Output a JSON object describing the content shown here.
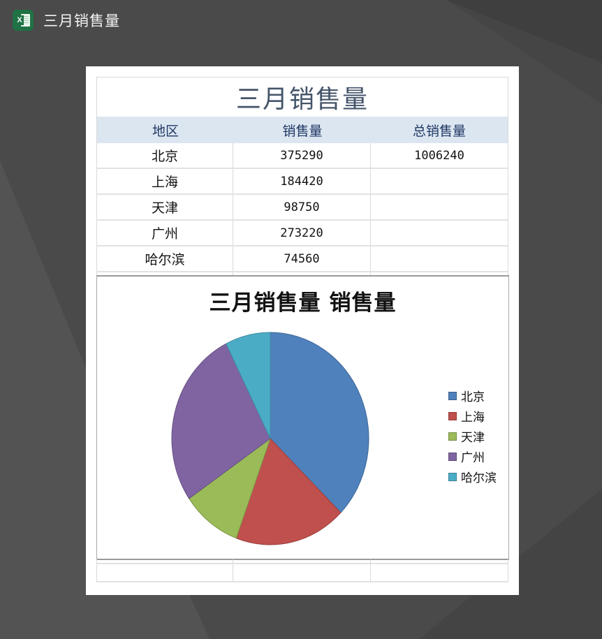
{
  "app": {
    "icon": "excel-icon",
    "icon_letter": "X",
    "title": "三月销售量"
  },
  "sheet": {
    "title": "三月销售量",
    "headers": [
      "地区",
      "销售量",
      "总销售量"
    ],
    "rows": [
      {
        "region": "北京",
        "sales": "375290",
        "total": "1006240"
      },
      {
        "region": "上海",
        "sales": "184420",
        "total": ""
      },
      {
        "region": "天津",
        "sales": "98750",
        "total": ""
      },
      {
        "region": "广州",
        "sales": "273220",
        "total": ""
      },
      {
        "region": "哈尔滨",
        "sales": "74560",
        "total": ""
      }
    ],
    "header_bg": "#dce6f1",
    "title_color": "#44546a"
  },
  "chart_data": {
    "type": "pie",
    "title_parts": [
      "三月销售量",
      "销售量"
    ],
    "title": "三月销售量 销售量",
    "categories": [
      "北京",
      "上海",
      "天津",
      "广州",
      "哈尔滨"
    ],
    "values": [
      375290,
      184420,
      98750,
      273220,
      74560
    ],
    "colors": [
      "#4f81bd",
      "#c0504d",
      "#9bbb59",
      "#8064a2",
      "#4bacc6"
    ],
    "start_angle_deg": 0,
    "direction": "clockwise",
    "legend_position": "right"
  }
}
